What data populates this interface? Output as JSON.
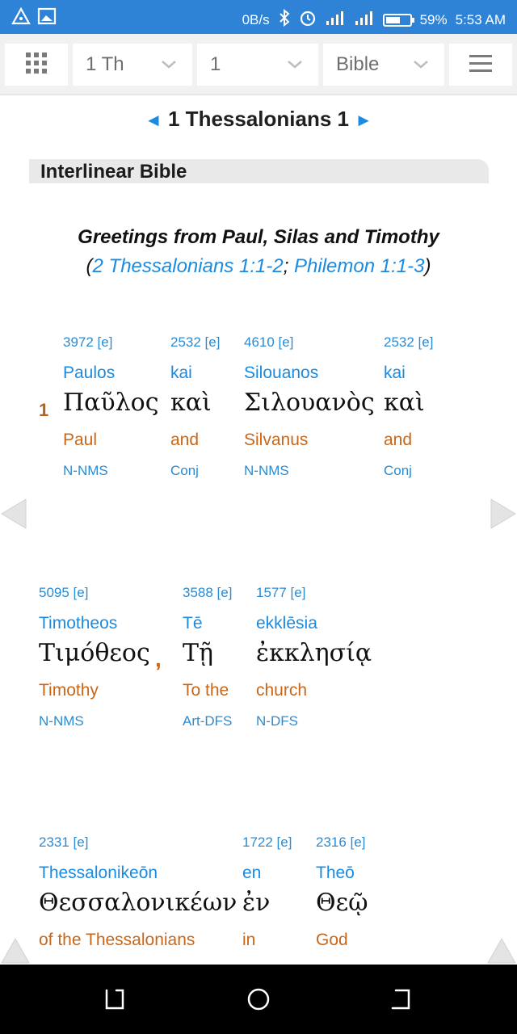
{
  "status_bar": {
    "net_speed": "0B/s",
    "battery_percent": "59%",
    "battery_level": 0.59,
    "time": "5:53 AM",
    "icons": [
      "triangle-warning-icon",
      "image-icon",
      "bluetooth-icon",
      "alarm-icon",
      "signal-icon",
      "signal-ht-icon",
      "battery-icon"
    ]
  },
  "toolbar": {
    "book": "1 Th",
    "chapter": "1",
    "version": "Bible"
  },
  "heading": {
    "prev_arrow": "◄",
    "title": "1 Thessalonians 1",
    "next_arrow": "►"
  },
  "section": {
    "label": "Interlinear Bible"
  },
  "greeting": {
    "title": "Greetings from Paul, Silas and Timothy",
    "open_paren": "(",
    "ref1": "2 Thessalonians 1:1-2",
    "separator": "; ",
    "ref2": "Philemon 1:1-3",
    "close_paren": ")"
  },
  "verse": {
    "number": "1",
    "comma": ","
  },
  "words": [
    {
      "strong": "3972 [e]",
      "translit": "Paulos",
      "greek": "Παῦλος",
      "english": "Paul",
      "parse": "N-NMS"
    },
    {
      "strong": "2532 [e]",
      "translit": "kai",
      "greek": "καὶ",
      "english": "and",
      "parse": "Conj"
    },
    {
      "strong": "4610 [e]",
      "translit": "Silouanos",
      "greek": "Σιλουανὸς",
      "english": "Silvanus",
      "parse": "N-NMS"
    },
    {
      "strong": "2532 [e]",
      "translit": "kai",
      "greek": "καὶ",
      "english": "and",
      "parse": "Conj"
    },
    {
      "strong": "5095 [e]",
      "translit": "Timotheos",
      "greek": "Τιμόθεος",
      "english": "Timothy",
      "parse": "N-NMS"
    },
    {
      "strong": "3588 [e]",
      "translit": "Tē",
      "greek": "Τῇ",
      "english": "To the",
      "parse": "Art-DFS"
    },
    {
      "strong": "1577 [e]",
      "translit": "ekklēsia",
      "greek": "ἐκκλησίᾳ",
      "english": "church",
      "parse": "N-DFS"
    },
    {
      "strong": "2331 [e]",
      "translit": "Thessalonikeōn",
      "greek": "Θεσσαλονικέων",
      "english": "of the Thessalonians",
      "parse": ""
    },
    {
      "strong": "1722 [e]",
      "translit": "en",
      "greek": "ἐν",
      "english": "in",
      "parse": ""
    },
    {
      "strong": "2316 [e]",
      "translit": "Theō",
      "greek": "Θεῷ",
      "english": "God",
      "parse": ""
    }
  ]
}
